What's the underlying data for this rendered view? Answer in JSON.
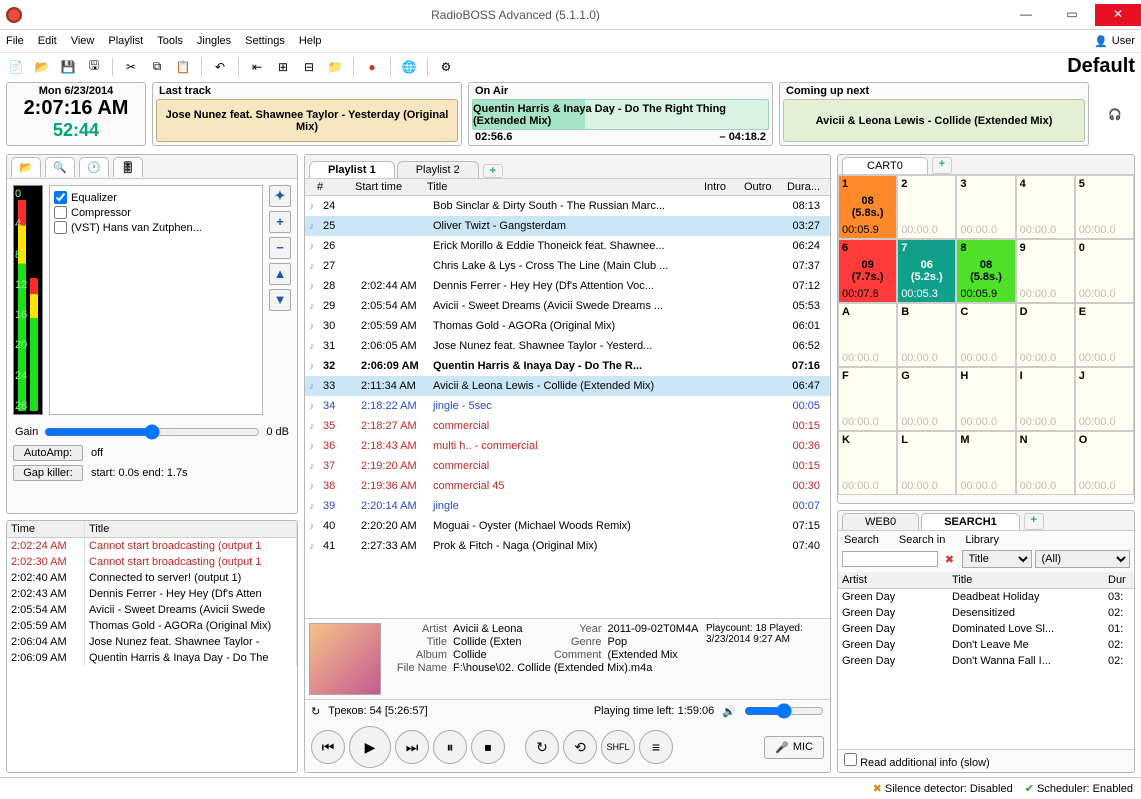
{
  "window": {
    "title": "RadioBOSS Advanced (5.1.1.0)",
    "user_label": "User",
    "profile_label": "Default"
  },
  "menu": [
    "File",
    "Edit",
    "View",
    "Playlist",
    "Tools",
    "Jingles",
    "Settings",
    "Help"
  ],
  "clock": {
    "date": "Mon 6/23/2014",
    "time": "2:07:16 AM",
    "remain": "52:44"
  },
  "last_track": {
    "label": "Last track",
    "text": "Jose Nunez feat. Shawnee Taylor - Yesterday (Original Mix)"
  },
  "on_air": {
    "label": "On Air",
    "text": "Quentin Harris & Inaya Day - Do The Right Thing (Extended Mix)",
    "elapsed": "02:56.6",
    "remaining": "– 04:18.2"
  },
  "next_track": {
    "label": "Coming up next",
    "text": "Avicii & Leona Lewis - Collide (Extended Mix)"
  },
  "fx": {
    "items": [
      "Equalizer",
      "Compressor",
      "(VST) Hans van Zutphen..."
    ],
    "checked": [
      true,
      false,
      false
    ]
  },
  "gain": {
    "label": "Gain",
    "value": "0 dB"
  },
  "autoamp": {
    "label": "AutoAmp:",
    "value": "off"
  },
  "gapkiller": {
    "label": "Gap killer:",
    "value": "start: 0.0s end: 1.7s"
  },
  "log": {
    "cols": [
      "Time",
      "Title"
    ],
    "rows": [
      {
        "t": "2:02:24 AM",
        "title": "Cannot start broadcasting (output 1",
        "red": true
      },
      {
        "t": "2:02:30 AM",
        "title": "Cannot start broadcasting (output 1",
        "red": true
      },
      {
        "t": "2:02:40 AM",
        "title": "Connected to server! (output 1)"
      },
      {
        "t": "2:02:43 AM",
        "title": "Dennis Ferrer - Hey Hey (Df's Atten"
      },
      {
        "t": "2:05:54 AM",
        "title": "Avicii - Sweet Dreams (Avicii Swede"
      },
      {
        "t": "2:05:59 AM",
        "title": "Thomas Gold - AGORa (Original Mix)"
      },
      {
        "t": "2:06:04 AM",
        "title": "Jose Nunez feat. Shawnee Taylor - "
      },
      {
        "t": "2:06:09 AM",
        "title": "Quentin Harris & Inaya Day - Do The"
      }
    ]
  },
  "playlist_tabs": [
    "Playlist 1",
    "Playlist 2"
  ],
  "pl_cols": [
    "#",
    "Start time",
    "Title",
    "Intro",
    "Outro",
    "Dura..."
  ],
  "playlist": [
    {
      "n": "24",
      "start": "",
      "title": "Bob Sinclar & Dirty South - The Russian Marc...",
      "dur": "08:13"
    },
    {
      "n": "25",
      "start": "",
      "title": "Oliver Twizt - Gangsterdam",
      "dur": "03:27",
      "sel": true
    },
    {
      "n": "26",
      "start": "",
      "title": "Erick Morillo & Eddie Thoneick feat. Shawnee...",
      "dur": "06:24"
    },
    {
      "n": "27",
      "start": "",
      "title": "Chris Lake & Lys - Cross The Line (Main Club ...",
      "dur": "07:37"
    },
    {
      "n": "28",
      "start": "2:02:44 AM",
      "title": "Dennis Ferrer - Hey Hey (Df's Attention Voc...",
      "dur": "07:12"
    },
    {
      "n": "29",
      "start": "2:05:54 AM",
      "title": "Avicii - Sweet Dreams (Avicii Swede Dreams ...",
      "dur": "05:53"
    },
    {
      "n": "30",
      "start": "2:05:59 AM",
      "title": "Thomas Gold - AGORa (Original Mix)",
      "dur": "06:01"
    },
    {
      "n": "31",
      "start": "2:06:05 AM",
      "title": "Jose Nunez feat. Shawnee Taylor - Yesterd...",
      "dur": "06:52"
    },
    {
      "n": "32",
      "start": "2:06:09 AM",
      "title": "Quentin Harris & Inaya Day - Do The R...",
      "dur": "07:16",
      "playing": true
    },
    {
      "n": "33",
      "start": "2:11:34 AM",
      "title": "Avicii & Leona Lewis - Collide (Extended Mix)",
      "dur": "06:47",
      "sel": true
    },
    {
      "n": "34",
      "start": "2:18:22 AM",
      "title": "jingle - 5sec",
      "dur": "00:05",
      "cls": "jingle"
    },
    {
      "n": "35",
      "start": "2:18:27 AM",
      "title": "commercial",
      "dur": "00:15",
      "cls": "commercial"
    },
    {
      "n": "36",
      "start": "2:18:43 AM",
      "title": "multi h.. - commercial",
      "dur": "00:36",
      "cls": "commercial"
    },
    {
      "n": "37",
      "start": "2:19:20 AM",
      "title": "commercial",
      "dur": "00:15",
      "cls": "commercial"
    },
    {
      "n": "38",
      "start": "2:19:36 AM",
      "title": "commercial 45",
      "dur": "00:30",
      "cls": "commercial"
    },
    {
      "n": "39",
      "start": "2:20:14 AM",
      "title": "jingle",
      "dur": "00:07",
      "cls": "jingle"
    },
    {
      "n": "40",
      "start": "2:20:20 AM",
      "title": "Moguai - Oyster (Michael Woods Remix)",
      "dur": "07:15"
    },
    {
      "n": "41",
      "start": "2:27:33 AM",
      "title": "Prok & Fitch - Naga (Original Mix)",
      "dur": "07:40"
    }
  ],
  "np": {
    "artist_k": "Artist",
    "artist": "Avicii & Leona",
    "title_k": "Title",
    "title": "Collide (Exten",
    "album_k": "Album",
    "album": "Collide",
    "file_k": "File Name",
    "file": "F:\\house\\02. Collide (Extended Mix).m4a",
    "year_k": "Year",
    "year": "2011-09-02T0M4A",
    "genre_k": "Genre",
    "genre": "Pop",
    "comment_k": "Comment",
    "comment": "(Extended Mix",
    "playcount": "Playcount: 18 Played: 3/23/2014 9:27 AM"
  },
  "status": {
    "tracks": "Треков: 54 [5:26:57]",
    "timeleft": "Playing time left: 1:59:06"
  },
  "mic": "MIC",
  "cart_tab": "CART0",
  "carts": [
    {
      "i": "1",
      "v": "08",
      "sub": "(5.8s.)",
      "d": "00:05.9",
      "cls": "hot1"
    },
    {
      "i": "2",
      "d": "00:00.0",
      "empty": true
    },
    {
      "i": "3",
      "d": "00:00.0",
      "empty": true
    },
    {
      "i": "4",
      "d": "00:00.0",
      "empty": true
    },
    {
      "i": "5",
      "d": "00:00.0",
      "empty": true
    },
    {
      "i": "6",
      "v": "09",
      "sub": "(7.7s.)",
      "d": "00:07.8",
      "cls": "hot6"
    },
    {
      "i": "7",
      "v": "06",
      "sub": "(5.2s.)",
      "d": "00:05.3",
      "cls": "hot7"
    },
    {
      "i": "8",
      "v": "08",
      "sub": "(5.8s.)",
      "d": "00:05.9",
      "cls": "hot8"
    },
    {
      "i": "9",
      "d": "00:00.0",
      "empty": true
    },
    {
      "i": "0",
      "d": "00:00.0",
      "empty": true
    },
    {
      "i": "A",
      "d": "00:00.0",
      "empty": true
    },
    {
      "i": "B",
      "d": "00:00.0",
      "empty": true
    },
    {
      "i": "C",
      "d": "00:00.0",
      "empty": true
    },
    {
      "i": "D",
      "d": "00:00.0",
      "empty": true
    },
    {
      "i": "E",
      "d": "00:00.0",
      "empty": true
    },
    {
      "i": "F",
      "d": "00:00.0",
      "empty": true
    },
    {
      "i": "G",
      "d": "00:00.0",
      "empty": true
    },
    {
      "i": "H",
      "d": "00:00.0",
      "empty": true
    },
    {
      "i": "I",
      "d": "00:00.0",
      "empty": true
    },
    {
      "i": "J",
      "d": "00:00.0",
      "empty": true
    },
    {
      "i": "K",
      "d": "00:00.0",
      "empty": true
    },
    {
      "i": "L",
      "d": "00:00.0",
      "empty": true
    },
    {
      "i": "M",
      "d": "00:00.0",
      "empty": true
    },
    {
      "i": "N",
      "d": "00:00.0",
      "empty": true
    },
    {
      "i": "O",
      "d": "00:00.0",
      "empty": true
    }
  ],
  "search_tabs": [
    "WEB0",
    "SEARCH1"
  ],
  "search": {
    "labels": [
      "Search",
      "Search in",
      "Library"
    ],
    "searchin": "Title",
    "library": "(All)",
    "cols": [
      "Artist",
      "Title",
      "Dur"
    ],
    "rows": [
      {
        "a": "Green Day",
        "t": "Deadbeat Holiday",
        "d": "03:"
      },
      {
        "a": "Green Day",
        "t": "Desensitized",
        "d": "02:"
      },
      {
        "a": "Green Day",
        "t": "Dominated Love Sl...",
        "d": "01:"
      },
      {
        "a": "Green Day",
        "t": "Don't Leave Me",
        "d": "02:"
      },
      {
        "a": "Green Day",
        "t": "Don't Wanna Fall I...",
        "d": "02:"
      }
    ],
    "readinfo": "Read additional info (slow)"
  },
  "bottom": {
    "silence": "Silence detector: Disabled",
    "sched": "Scheduler: Enabled"
  }
}
